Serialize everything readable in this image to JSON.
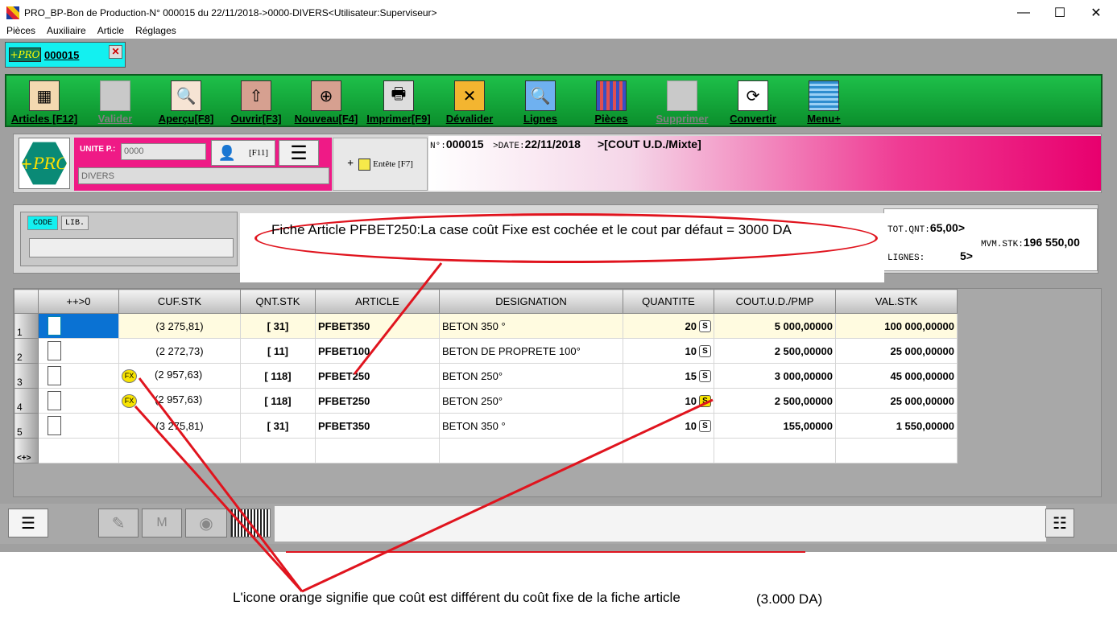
{
  "window": {
    "title": "PRO_BP-Bon de Production-N° 000015 du 22/11/2018->0000-DIVERS<Utilisateur:Superviseur>",
    "minimize": "—",
    "maximize": "☐",
    "close": "✕"
  },
  "menu": [
    "Pièces",
    "Auxiliaire",
    "Article",
    "Réglages"
  ],
  "doc_tab": {
    "logo": "+PRO",
    "label": "000015",
    "close": "✕"
  },
  "toolbar": [
    {
      "label": "Articles [F12]",
      "icon": "articles-icon",
      "disabled": false
    },
    {
      "label": "Valider",
      "icon": "validate-icon",
      "disabled": true
    },
    {
      "label": "Aperçu[F8]",
      "icon": "preview-icon",
      "disabled": false
    },
    {
      "label": "Ouvrir[F3]",
      "icon": "open-icon",
      "disabled": false
    },
    {
      "label": "Nouveau[F4]",
      "icon": "new-icon",
      "disabled": false
    },
    {
      "label": "Imprimer[F9]",
      "icon": "printer-icon",
      "disabled": false
    },
    {
      "label": "Dévalider",
      "icon": "unvalidate-icon",
      "disabled": false
    },
    {
      "label": "Lignes",
      "icon": "search-icon",
      "disabled": false
    },
    {
      "label": "Pièces",
      "icon": "grid-icon",
      "disabled": false
    },
    {
      "label": "Supprimer",
      "icon": "delete-icon",
      "disabled": true
    },
    {
      "label": "Convertir",
      "icon": "convert-icon",
      "disabled": false
    },
    {
      "label": "Menu+",
      "icon": "menu-icon",
      "disabled": false
    }
  ],
  "header": {
    "logo": "+PRO",
    "unit_label": "UNITE P.:",
    "unit_value": "0000",
    "client": "DIVERS",
    "user_key": "[F11]",
    "entete": "Entête [F7]",
    "num_key": "N°:",
    "num_value": "000015",
    "date_key": ">DATE:",
    "date_value": "22/11/2018",
    "mode_value": ">[COUT U.D./Mixte]"
  },
  "code_panel": {
    "code_btn": "CODE",
    "lib_btn": "LIB."
  },
  "totals": {
    "tot_qnt_key": "TOT.QNT:",
    "tot_qnt_val": "65,00>",
    "mvm_stk_key": "MVM.STK:",
    "mvm_stk_val": "196 550,00",
    "lignes_key": "LIGNES:",
    "lignes_val": "5>"
  },
  "callout": {
    "text": "Fiche Article PFBET250:La case coût Fixe est cochée et le cout par défaut = 3000 DA"
  },
  "grid": {
    "columns": [
      "",
      "++>0",
      "CUF.STK",
      "QNT.STK",
      "ARTICLE",
      "DESIGNATION",
      "QUANTITE",
      "COUT.U.D./PMP",
      "VAL.STK"
    ],
    "rows": [
      {
        "num": "1",
        "fx": false,
        "cuf": "(3 275,81)",
        "qnt": "[ 31]",
        "article": "PFBET350",
        "designation": "BETON 350 °",
        "quantite": "20",
        "s": "S",
        "s_yellow": false,
        "cout": "5 000,00000",
        "val": "100 000,00000"
      },
      {
        "num": "2",
        "fx": false,
        "cuf": "(2 272,73)",
        "qnt": "[ 11]",
        "article": "PFBET100",
        "designation": "BETON DE PROPRETE 100°",
        "quantite": "10",
        "s": "S",
        "s_yellow": false,
        "cout": "2 500,00000",
        "val": "25 000,00000"
      },
      {
        "num": "3",
        "fx": true,
        "cuf": "(2 957,63)",
        "qnt": "[ 118]",
        "article": "PFBET250",
        "designation": "BETON 250°",
        "quantite": "15",
        "s": "S",
        "s_yellow": false,
        "cout": "3 000,00000",
        "val": "45 000,00000"
      },
      {
        "num": "4",
        "fx": true,
        "cuf": "(2 957,63)",
        "qnt": "[ 118]",
        "article": "PFBET250",
        "designation": "BETON 250°",
        "quantite": "10",
        "s": "S",
        "s_yellow": true,
        "cout": "2 500,00000",
        "val": "25 000,00000"
      },
      {
        "num": "5",
        "fx": false,
        "cuf": "(3 275,81)",
        "qnt": "[ 31]",
        "article": "PFBET350",
        "designation": "BETON 350 °",
        "quantite": "10",
        "s": "S",
        "s_yellow": false,
        "cout": "155,00000",
        "val": "1 550,00000"
      }
    ],
    "footer_num": "<+>",
    "fx_label": "FX"
  },
  "bottom_note": {
    "text": "L'icone orange signifie que coût est différent du coût fixe de la fiche article",
    "amount": "(3.000 DA)"
  },
  "colors": {
    "toolbar_green": "#0b8f2c",
    "header_pink": "#ef1a86",
    "tab_cyan": "#13f0f0",
    "annotation_red": "#e0141e",
    "fx_yellow": "#f8e400"
  }
}
